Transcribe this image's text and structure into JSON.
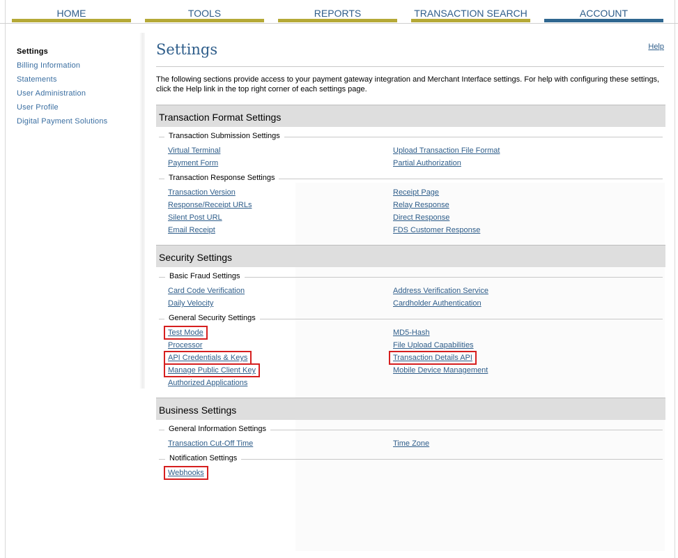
{
  "nav": [
    {
      "label": "HOME",
      "active": false
    },
    {
      "label": "TOOLS",
      "active": false
    },
    {
      "label": "REPORTS",
      "active": false
    },
    {
      "label": "TRANSACTION SEARCH",
      "active": false
    },
    {
      "label": "ACCOUNT",
      "active": true
    }
  ],
  "sidebar": {
    "items": [
      {
        "label": "Settings"
      },
      {
        "label": "Billing Information"
      },
      {
        "label": "Statements"
      },
      {
        "label": "User Administration"
      },
      {
        "label": "User Profile"
      },
      {
        "label": "Digital Payment Solutions"
      }
    ]
  },
  "page": {
    "title": "Settings",
    "help": "Help",
    "intro": "The following sections provide access to your payment gateway integration and Merchant Interface settings. For help with configuring these settings, click the Help link in the top right corner of each settings page."
  },
  "sections": {
    "transaction_format": {
      "title": "Transaction Format Settings",
      "submission": {
        "title": "Transaction Submission Settings",
        "left": [
          "Virtual Terminal",
          "Payment Form"
        ],
        "right": [
          "Upload Transaction File Format",
          "Partial Authorization"
        ]
      },
      "response": {
        "title": "Transaction Response Settings",
        "left": [
          "Transaction Version",
          "Response/Receipt URLs",
          "Silent Post URL",
          "Email Receipt"
        ],
        "right": [
          "Receipt Page",
          "Relay Response",
          "Direct Response",
          "FDS Customer Response"
        ]
      }
    },
    "security": {
      "title": "Security Settings",
      "fraud": {
        "title": "Basic Fraud Settings",
        "left": [
          "Card Code Verification",
          "Daily Velocity"
        ],
        "right": [
          "Address Verification Service",
          "Cardholder Authentication"
        ]
      },
      "general": {
        "title": "General Security Settings",
        "left": [
          "Test Mode",
          "Processor",
          "API Credentials & Keys",
          "Manage Public Client Key",
          "Authorized Applications"
        ],
        "right": [
          "MD5-Hash",
          "File Upload Capabilities",
          "Transaction Details API",
          "Mobile Device Management"
        ]
      }
    },
    "business": {
      "title": "Business Settings",
      "general_info": {
        "title": "General Information Settings",
        "left": [
          "Transaction Cut-Off Time"
        ],
        "right": [
          "Time Zone"
        ]
      },
      "notification": {
        "title": "Notification Settings",
        "left": [
          "Webhooks"
        ]
      }
    }
  },
  "colors": {
    "link": "#2e5d8a",
    "nav_underline": "#b5a937",
    "nav_active_underline": "#2f6790",
    "highlight_box": "#d61f1f",
    "section_header_bg": "#dedede"
  }
}
